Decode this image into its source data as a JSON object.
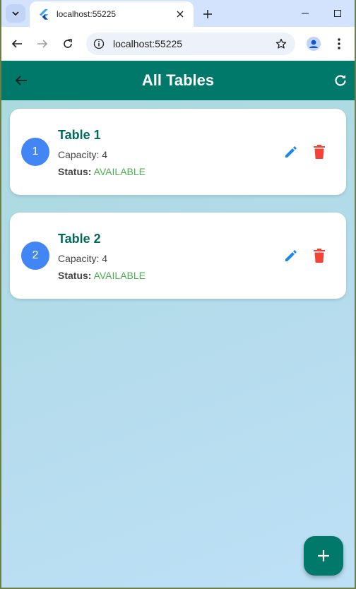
{
  "browser": {
    "tab_title": "localhost:55225",
    "url": "localhost:55225"
  },
  "appbar": {
    "title": "All Tables"
  },
  "tables": [
    {
      "number": "1",
      "name": "Table 1",
      "capacity": "Capacity: 4",
      "status_label": "Status:",
      "status_value": "AVAILABLE"
    },
    {
      "number": "2",
      "name": "Table 2",
      "capacity": "Capacity: 4",
      "status_label": "Status:",
      "status_value": "AVAILABLE"
    }
  ],
  "icons": {
    "back": "arrow-left-icon",
    "refresh": "refresh-icon",
    "edit": "pencil-icon",
    "delete": "trash-icon",
    "add": "plus-icon"
  },
  "colors": {
    "appbar": "#00796b",
    "title_text": "#00695c",
    "avatar": "#4285f4",
    "edit": "#1e88e5",
    "delete": "#f44336",
    "status_available": "#4caf50"
  }
}
